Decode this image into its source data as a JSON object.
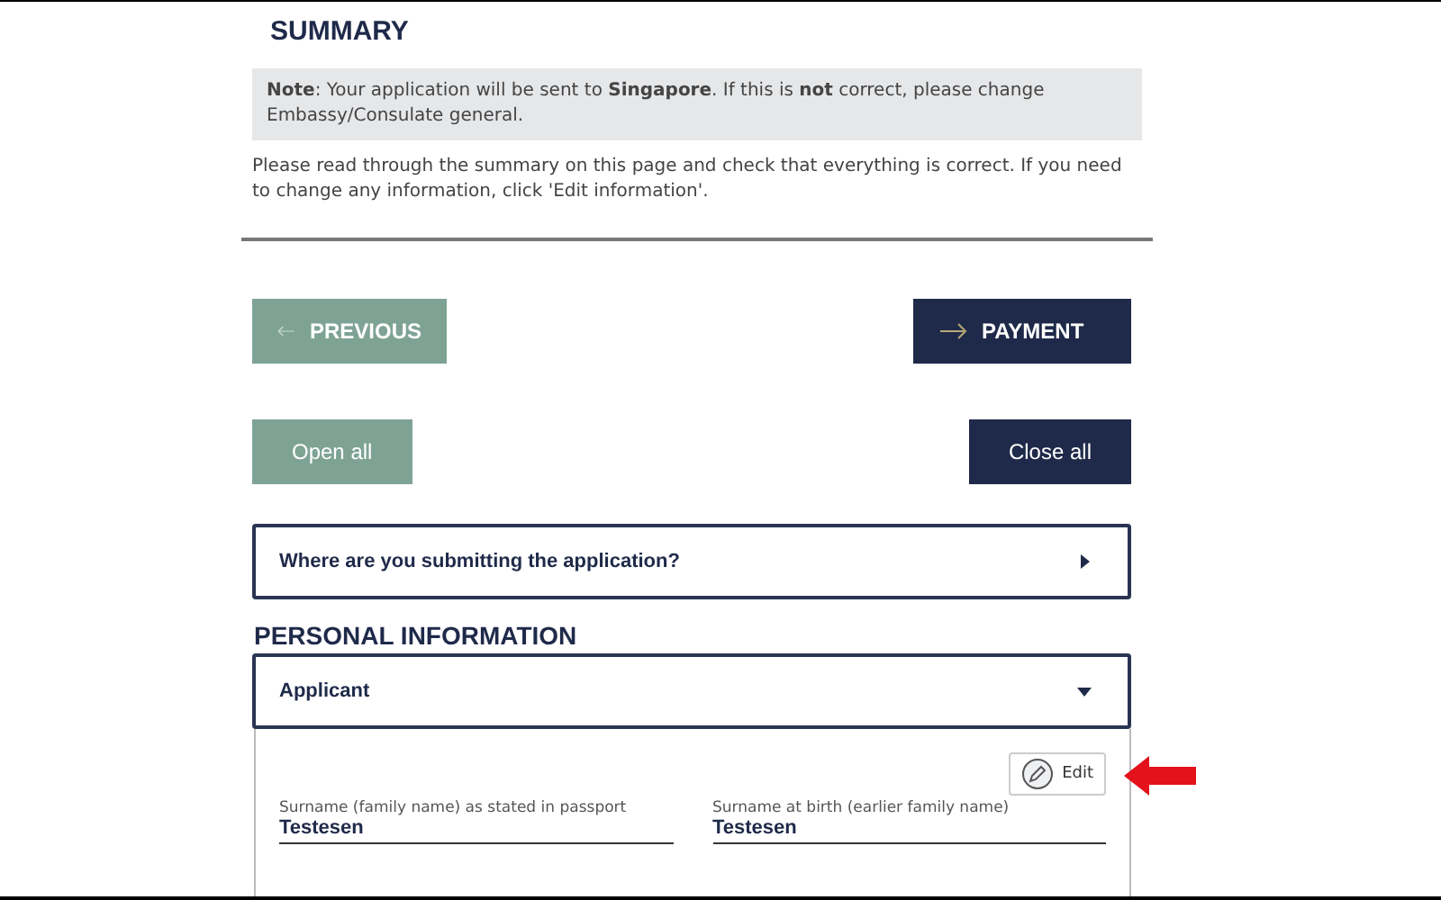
{
  "heading": "SUMMARY",
  "note": "**Note**: Your application will be sent to **Singapore**. If this is **not** correct, please change Embassy/Consulate general.",
  "intro": "Please read through the summary on this page and check that everything is correct. If you need to change any information, click 'Edit information'.",
  "nav_buttons": [
    {
      "label": "PREVIOUS",
      "kind": "secondary"
    },
    {
      "label": "PAYMENT",
      "kind": "primary"
    }
  ],
  "toggle_buttons": [
    {
      "label": "Open all",
      "kind": "secondary"
    },
    {
      "label": "Close all",
      "kind": "primary"
    }
  ],
  "submission_section": {
    "title": "Where are you submitting the application?",
    "expanded": false
  },
  "personal_information": {
    "heading": "PERSONAL INFORMATION",
    "section": {
      "title": "Applicant",
      "expanded": true
    },
    "edit_button": "Edit",
    "fields": [
      {
        "label": "Surname (family name) as stated in passport",
        "value": "Testesen"
      },
      {
        "label": "Surname at birth (earlier family name)",
        "value": "Testesen"
      }
    ]
  }
}
